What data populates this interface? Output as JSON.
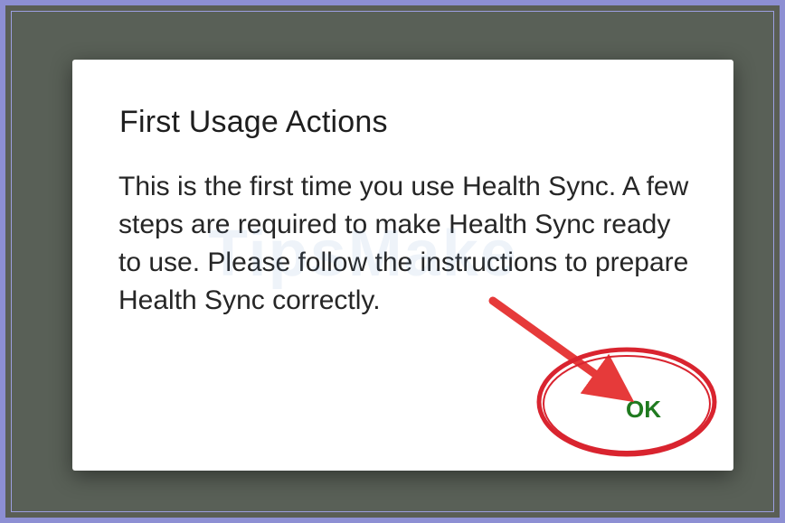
{
  "dialog": {
    "title": "First Usage Actions",
    "message": "This is the first time you use Health Sync. A few steps are required to make Health Sync ready to use. Please follow the instructions to prepare Health Sync correctly.",
    "ok_label": "OK"
  },
  "watermark": {
    "text": "TipsMake"
  },
  "colors": {
    "frame_border": "#8d8fd3",
    "scrim": "#596057",
    "dialog_bg": "#ffffff",
    "title_text": "#1e1e1e",
    "ok_text": "#1f7a1f",
    "annotation_red": "#d9242f"
  }
}
